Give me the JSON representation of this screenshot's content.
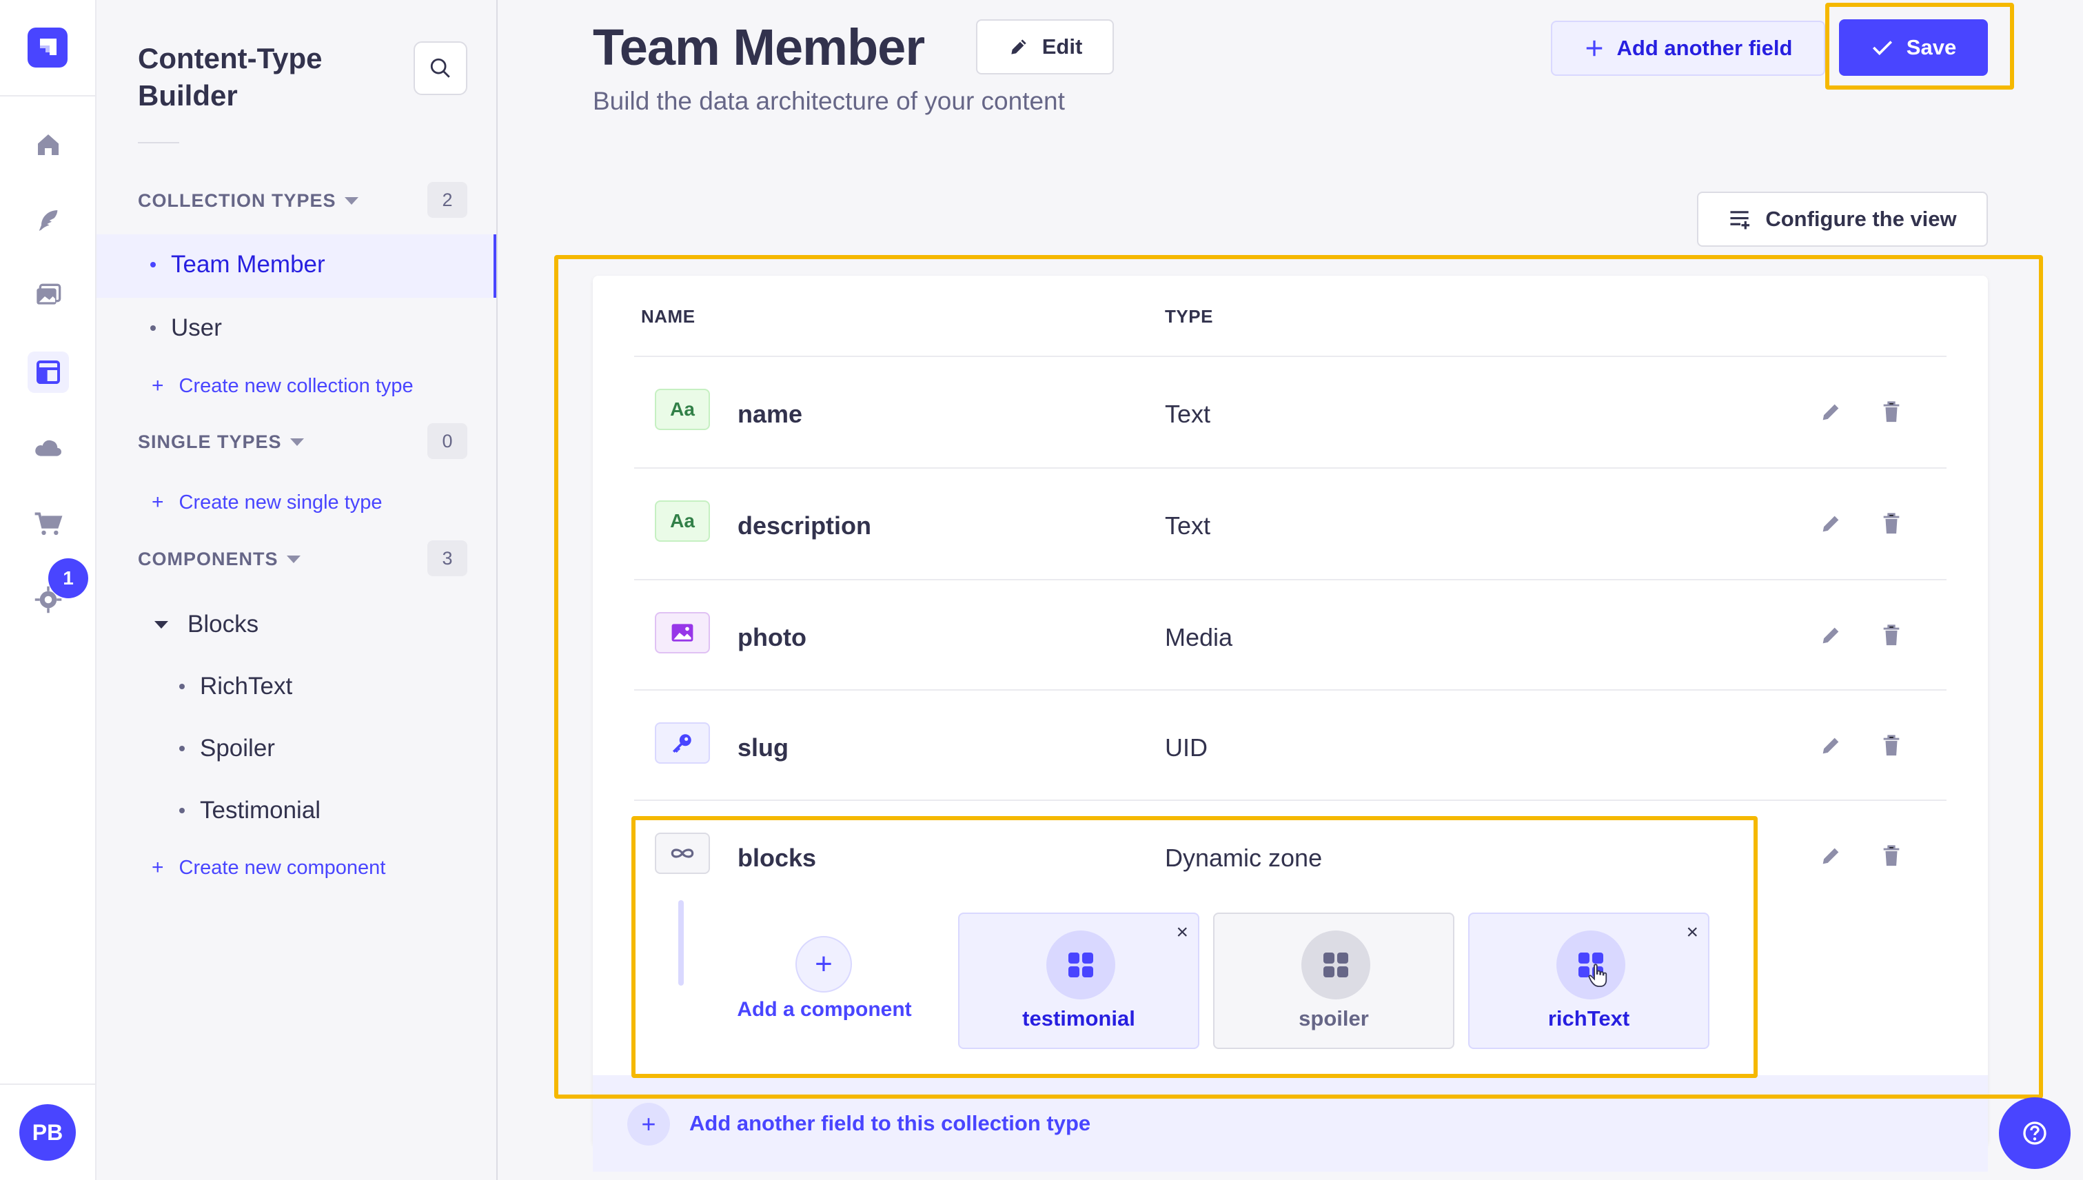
{
  "rail": {
    "notification_count": "1",
    "user_initials": "PB",
    "icons": [
      "home-icon",
      "feather-icon",
      "media-library-icon",
      "layout-icon",
      "cloud-icon",
      "cart-icon",
      "gear-icon"
    ]
  },
  "subnav": {
    "title": "Content-Type Builder",
    "collection_types": {
      "label": "COLLECTION TYPES",
      "count": "2",
      "items": [
        "Team Member",
        "User"
      ],
      "active": "Team Member",
      "create_label": "Create new collection type"
    },
    "single_types": {
      "label": "SINGLE TYPES",
      "count": "0",
      "create_label": "Create new single type"
    },
    "components": {
      "label": "COMPONENTS",
      "count": "3",
      "group": "Blocks",
      "items": [
        "RichText",
        "Spoiler",
        "Testimonial"
      ],
      "create_label": "Create new component"
    }
  },
  "header": {
    "title": "Team Member",
    "subtitle": "Build the data architecture of your content",
    "edit_label": "Edit",
    "add_field_label": "Add another field",
    "save_label": "Save",
    "configure_label": "Configure the view"
  },
  "table": {
    "columns": [
      "NAME",
      "TYPE"
    ],
    "rows": [
      {
        "name": "name",
        "type": "Text",
        "icon": "text-icon",
        "icon_text": "Aa"
      },
      {
        "name": "description",
        "type": "Text",
        "icon": "text-icon",
        "icon_text": "Aa"
      },
      {
        "name": "photo",
        "type": "Media",
        "icon": "media-icon",
        "icon_text": ""
      },
      {
        "name": "slug",
        "type": "UID",
        "icon": "key-icon",
        "icon_text": ""
      },
      {
        "name": "blocks",
        "type": "Dynamic zone",
        "icon": "infinity-icon",
        "icon_text": ""
      }
    ],
    "dynamic_zone": {
      "add_component_label": "Add a component",
      "components": [
        {
          "name": "testimonial",
          "selected": true,
          "removable": true
        },
        {
          "name": "spoiler",
          "selected": false,
          "removable": false
        },
        {
          "name": "richText",
          "selected": true,
          "removable": true
        }
      ]
    },
    "add_row_label": "Add another field to this collection type"
  },
  "colors": {
    "primary": "#4945ff",
    "highlight": "#f5b800",
    "text": "#32324d",
    "muted": "#666687"
  }
}
